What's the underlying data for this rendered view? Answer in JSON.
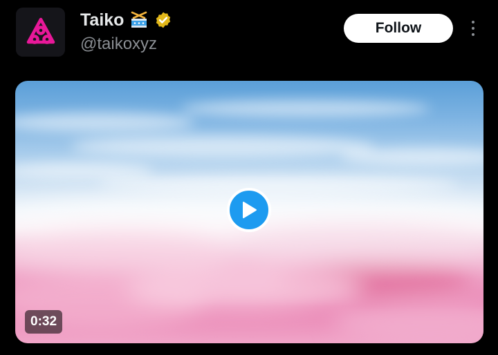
{
  "author": {
    "display_name": "Taiko",
    "handle": "@taikoxyz",
    "avatar_icon": "taiko-logo-icon",
    "badges": [
      "drum-emoji-icon",
      "verified-badge-icon"
    ]
  },
  "follow_button": {
    "label": "Follow"
  },
  "more_menu": {
    "icon": "more-options-icon"
  },
  "media": {
    "type": "video",
    "duration": "0:32",
    "play_icon": "play-icon"
  },
  "colors": {
    "background": "#000000",
    "brand_pink": "#e81899",
    "play_blue": "#1d9bf0",
    "verified_gold": "#e2b719"
  }
}
